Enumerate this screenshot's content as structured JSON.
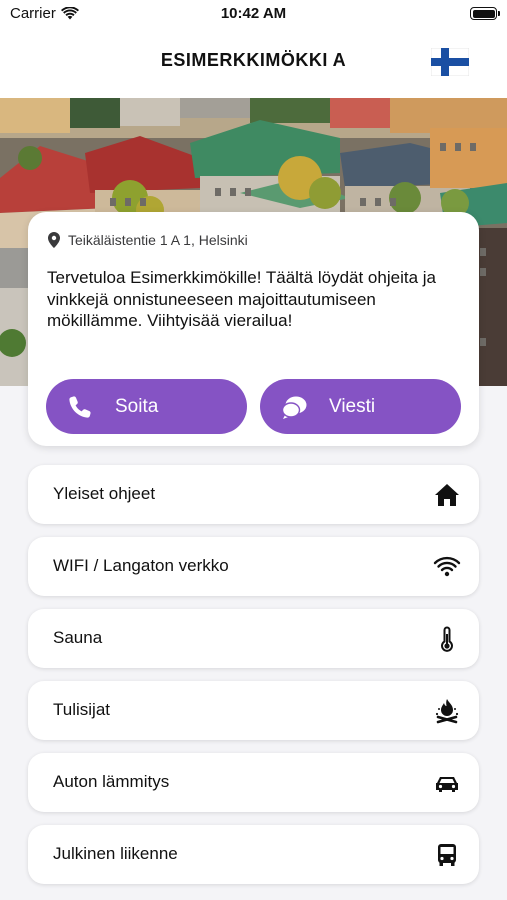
{
  "status_bar": {
    "carrier": "Carrier",
    "time": "10:42 AM",
    "battery_level": 1.0
  },
  "nav": {
    "title": "ESIMERKKIMÖKKI A",
    "language_flag": "finland-flag-icon"
  },
  "welcome_card": {
    "address": "Teikäläistentie 1 A 1, Helsinki",
    "message": "Tervetuloa Esimerkkimökille! Täältä löydät ohjeita ja vinkkejä onnistuneeseen majoittautumiseen mökillämme. Viihtyisää vierailua!",
    "call_label": "Soita",
    "message_label": "Viesti"
  },
  "menu": [
    {
      "label": "Yleiset ohjeet",
      "icon": "home-icon"
    },
    {
      "label": "WIFI / Langaton verkko",
      "icon": "wifi-icon"
    },
    {
      "label": "Sauna",
      "icon": "thermometer-icon"
    },
    {
      "label": "Tulisijat",
      "icon": "campfire-icon"
    },
    {
      "label": "Auton lämmitys",
      "icon": "car-icon"
    },
    {
      "label": "Julkinen liikenne",
      "icon": "bus-icon"
    }
  ],
  "colors": {
    "accent": "#8553C4",
    "background": "#F4F4F7",
    "card": "#FFFFFF"
  }
}
